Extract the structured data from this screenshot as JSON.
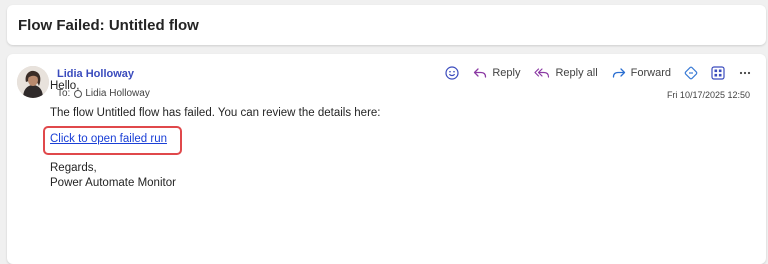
{
  "subject": "Flow Failed: Untitled flow",
  "sender": {
    "name": "Lidia Holloway",
    "avatar_icon": "person-avatar"
  },
  "to": {
    "prefix": "To:",
    "recipient": "Lidia Holloway"
  },
  "date": "Fri 10/17/2025 12:50",
  "toolbar": {
    "emoji_icon": "smiley-icon",
    "reply_label": "Reply",
    "reply_all_label": "Reply all",
    "forward_label": "Forward",
    "accent_color": "#3a4bbd"
  },
  "body": {
    "greeting": "Hello,",
    "paragraph": "The flow Untitled flow has failed. You can review the details here:",
    "link_text": "Click to open failed run",
    "regards": "Regards,",
    "signature": "Power Automate Monitor"
  },
  "colors": {
    "link": "#1a3fd6",
    "highlight_box": "#e0484b",
    "sender": "#3a4bbd"
  }
}
